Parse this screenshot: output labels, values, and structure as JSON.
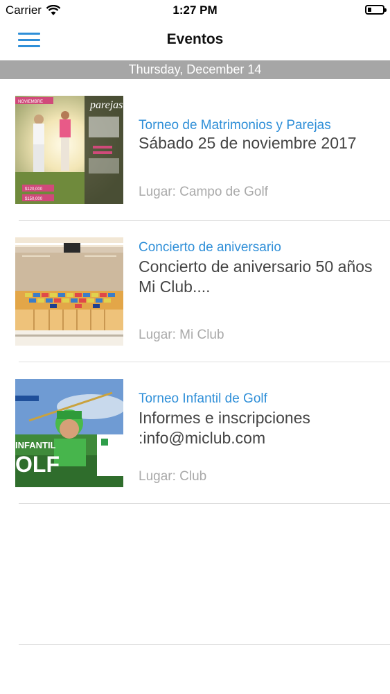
{
  "status_bar": {
    "carrier": "Carrier",
    "time": "1:27 PM"
  },
  "nav": {
    "title": "Eventos",
    "menu_icon": "hamburger-menu-icon"
  },
  "date_header": "Thursday, December 14",
  "events": [
    {
      "title": "Torneo de Matrimonios y Parejas",
      "description": "Sábado 25 de noviembre 2017",
      "place": "Lugar: Campo de Golf",
      "poster_heading": "parejas",
      "poster_month": "NOVIEMBRE",
      "poster_prices": [
        "$120,000",
        "$150,000"
      ]
    },
    {
      "title": "Concierto de aniversario",
      "description": "Concierto de aniversario 50 años Mi Club....",
      "place": "Lugar: Mi Club"
    },
    {
      "title": "Torneo Infantil de Golf",
      "description": "Informes e inscripciones :info@miclub.com",
      "place": "Lugar: Club",
      "poster_word_1": "INFANTIL",
      "poster_word_2": "OLF"
    }
  ],
  "colors": {
    "accent": "#2f8fd8",
    "date_header_bg": "#a6a6a6",
    "place_text": "#a9a9a9"
  }
}
